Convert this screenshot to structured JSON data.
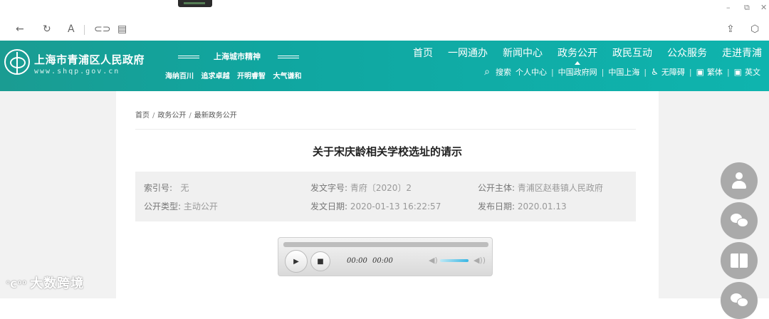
{
  "browser": {
    "window_controls": [
      "–",
      "⧉",
      "✕"
    ],
    "toolbar": {
      "back_icon": "back-arrow-icon",
      "reload_icon": "reload-icon",
      "reader_label": "A",
      "link_icon": "link-icon",
      "tab_icon": "tab-icon",
      "share_icon": "share-icon",
      "extension_icon": "extension-icon"
    }
  },
  "site": {
    "title": "上海市青浦区人民政府",
    "url": "www.shqp.gov.cn",
    "spirit_title": "上海城市精神",
    "spirit_words": [
      "海纳百川",
      "追求卓越",
      "开明睿智",
      "大气谦和"
    ],
    "nav": [
      "首页",
      "一网通办",
      "新闻中心",
      "政务公开",
      "政民互动",
      "公众服务",
      "走进青浦"
    ],
    "active_nav": "政务公开",
    "subnav": {
      "search": "搜索",
      "links": [
        "个人中心",
        "中国政府网",
        "中国上海",
        "无障碍",
        "繁体",
        "英文"
      ]
    }
  },
  "breadcrumb": [
    "首页",
    "政务公开",
    "最新政务公开"
  ],
  "document": {
    "title": "关于宋庆龄相关学校选址的请示",
    "meta": {
      "index_label": "索引号:",
      "index_value": "无",
      "doc_no_label": "发文字号:",
      "doc_no_value": "青府〔2020〕2",
      "publisher_label": "公开主体:",
      "publisher_value": "青浦区赵巷镇人民政府",
      "type_label": "公开类型:",
      "type_value": "主动公开",
      "issue_date_label": "发文日期:",
      "issue_date_value": "2020-01-13 16:22:57",
      "publish_date_label": "发布日期:",
      "publish_date_value": "2020.01.13"
    }
  },
  "player": {
    "current_time": "00:00",
    "duration": "00:00"
  },
  "watermark": "大数跨境",
  "watermark_logo": "℃⁰⁰"
}
